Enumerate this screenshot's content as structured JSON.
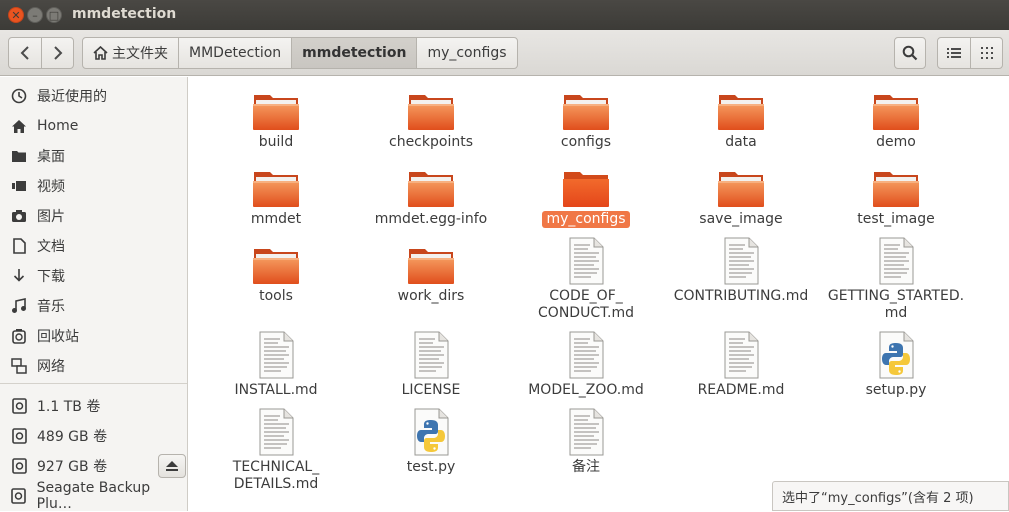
{
  "window": {
    "title": "mmdetection"
  },
  "breadcrumbs": [
    {
      "label": "主文件夹",
      "icon": "home-icon"
    },
    {
      "label": "MMDetection"
    },
    {
      "label": "mmdetection",
      "active": true
    },
    {
      "label": "my_configs"
    }
  ],
  "sidebar": {
    "places": [
      {
        "label": "最近使用的",
        "icon": "recent-icon"
      },
      {
        "label": "Home",
        "icon": "home-icon"
      },
      {
        "label": "桌面",
        "icon": "desktop-icon"
      },
      {
        "label": "视频",
        "icon": "video-icon"
      },
      {
        "label": "图片",
        "icon": "camera-icon"
      },
      {
        "label": "文档",
        "icon": "document-icon"
      },
      {
        "label": "下载",
        "icon": "download-icon"
      },
      {
        "label": "音乐",
        "icon": "music-icon"
      },
      {
        "label": "回收站",
        "icon": "trash-icon"
      },
      {
        "label": "网络",
        "icon": "network-icon"
      }
    ],
    "devices": [
      {
        "label": "1.1 TB 卷",
        "icon": "drive-icon"
      },
      {
        "label": "489 GB 卷",
        "icon": "drive-icon"
      },
      {
        "label": "927 GB 卷",
        "icon": "drive-icon",
        "ejectable": true
      },
      {
        "label": "Seagate Backup Plu…",
        "icon": "drive-icon"
      }
    ]
  },
  "files": [
    {
      "name": "build",
      "type": "folder"
    },
    {
      "name": "checkpoints",
      "type": "folder"
    },
    {
      "name": "configs",
      "type": "folder"
    },
    {
      "name": "data",
      "type": "folder"
    },
    {
      "name": "demo",
      "type": "folder"
    },
    {
      "name": "mmdet",
      "type": "folder"
    },
    {
      "name": "mmdet.egg-info",
      "type": "folder"
    },
    {
      "name": "my_configs",
      "type": "folder",
      "selected": true
    },
    {
      "name": "save_image",
      "type": "folder"
    },
    {
      "name": "test_image",
      "type": "folder"
    },
    {
      "name": "tools",
      "type": "folder"
    },
    {
      "name": "work_dirs",
      "type": "folder"
    },
    {
      "name": "CODE_OF_\nCONDUCT.md",
      "type": "text"
    },
    {
      "name": "CONTRIBUTING.md",
      "type": "text"
    },
    {
      "name": "GETTING_STARTED.\nmd",
      "type": "text"
    },
    {
      "name": "INSTALL.md",
      "type": "text"
    },
    {
      "name": "LICENSE",
      "type": "text"
    },
    {
      "name": "MODEL_ZOO.md",
      "type": "text"
    },
    {
      "name": "README.md",
      "type": "text"
    },
    {
      "name": "setup.py",
      "type": "python"
    },
    {
      "name": "TECHNICAL_\nDETAILS.md",
      "type": "text"
    },
    {
      "name": "test.py",
      "type": "python"
    },
    {
      "name": "备注",
      "type": "text"
    }
  ],
  "status": {
    "text": "选中了“my_configs”(含有 2 项)"
  },
  "colors": {
    "accent": "#e95420",
    "selection": "#f07746",
    "folder_light": "#f4a06a",
    "folder_dark": "#e2551f"
  }
}
